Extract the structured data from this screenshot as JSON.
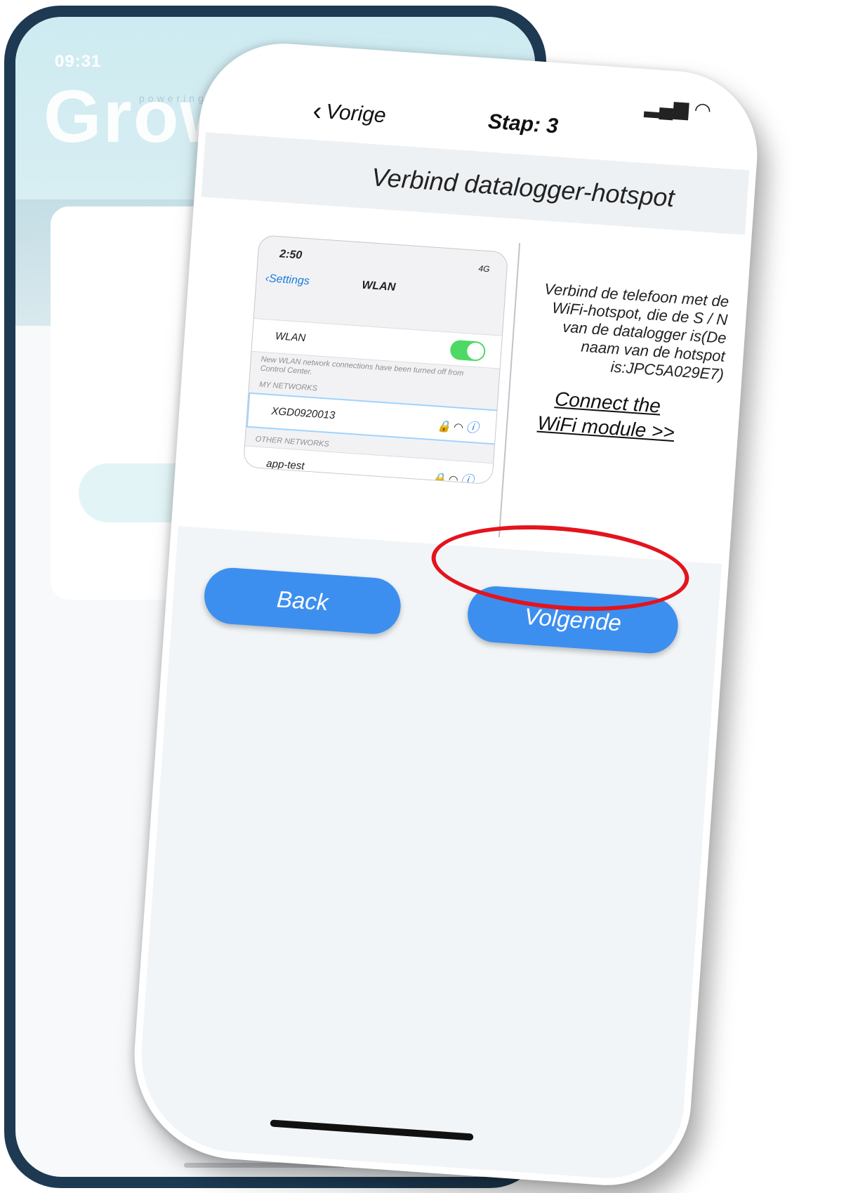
{
  "background_app": {
    "time": "09:31",
    "logo": "Growatt",
    "tagline": "powering tomorrow"
  },
  "status_bar": {
    "signal_wifi": "▂▄▆ ◠"
  },
  "nav": {
    "back_label": "Vorige",
    "title": "Stap: 3"
  },
  "section": {
    "title": "Verbind datalogger-hotspot"
  },
  "example_screenshot": {
    "time": "2:50",
    "status": "4G",
    "back_label": "Settings",
    "title": "WLAN",
    "wlan_label": "WLAN",
    "wlan_note": "New WLAN network connections have been turned off from Control Center.",
    "my_networks_caption": "MY NETWORKS",
    "my_network": "XGD0920013",
    "other_networks_caption": "OTHER NETWORKS",
    "other_network": "app-test"
  },
  "instruction": {
    "text": "Verbind de telefoon met de WiFi-hotspot, die de S / N van de datalogger is(De naam van de hotspot is:JPC5A029E7)",
    "link_line1": "Connect the",
    "link_line2": "WiFi module >>"
  },
  "buttons": {
    "back": "Back",
    "next": "Volgende"
  },
  "colors": {
    "button_blue": "#3d8fef",
    "highlight_red": "#e3141e",
    "frame_navy": "#1d3a52",
    "toggle_green": "#4cd964"
  }
}
